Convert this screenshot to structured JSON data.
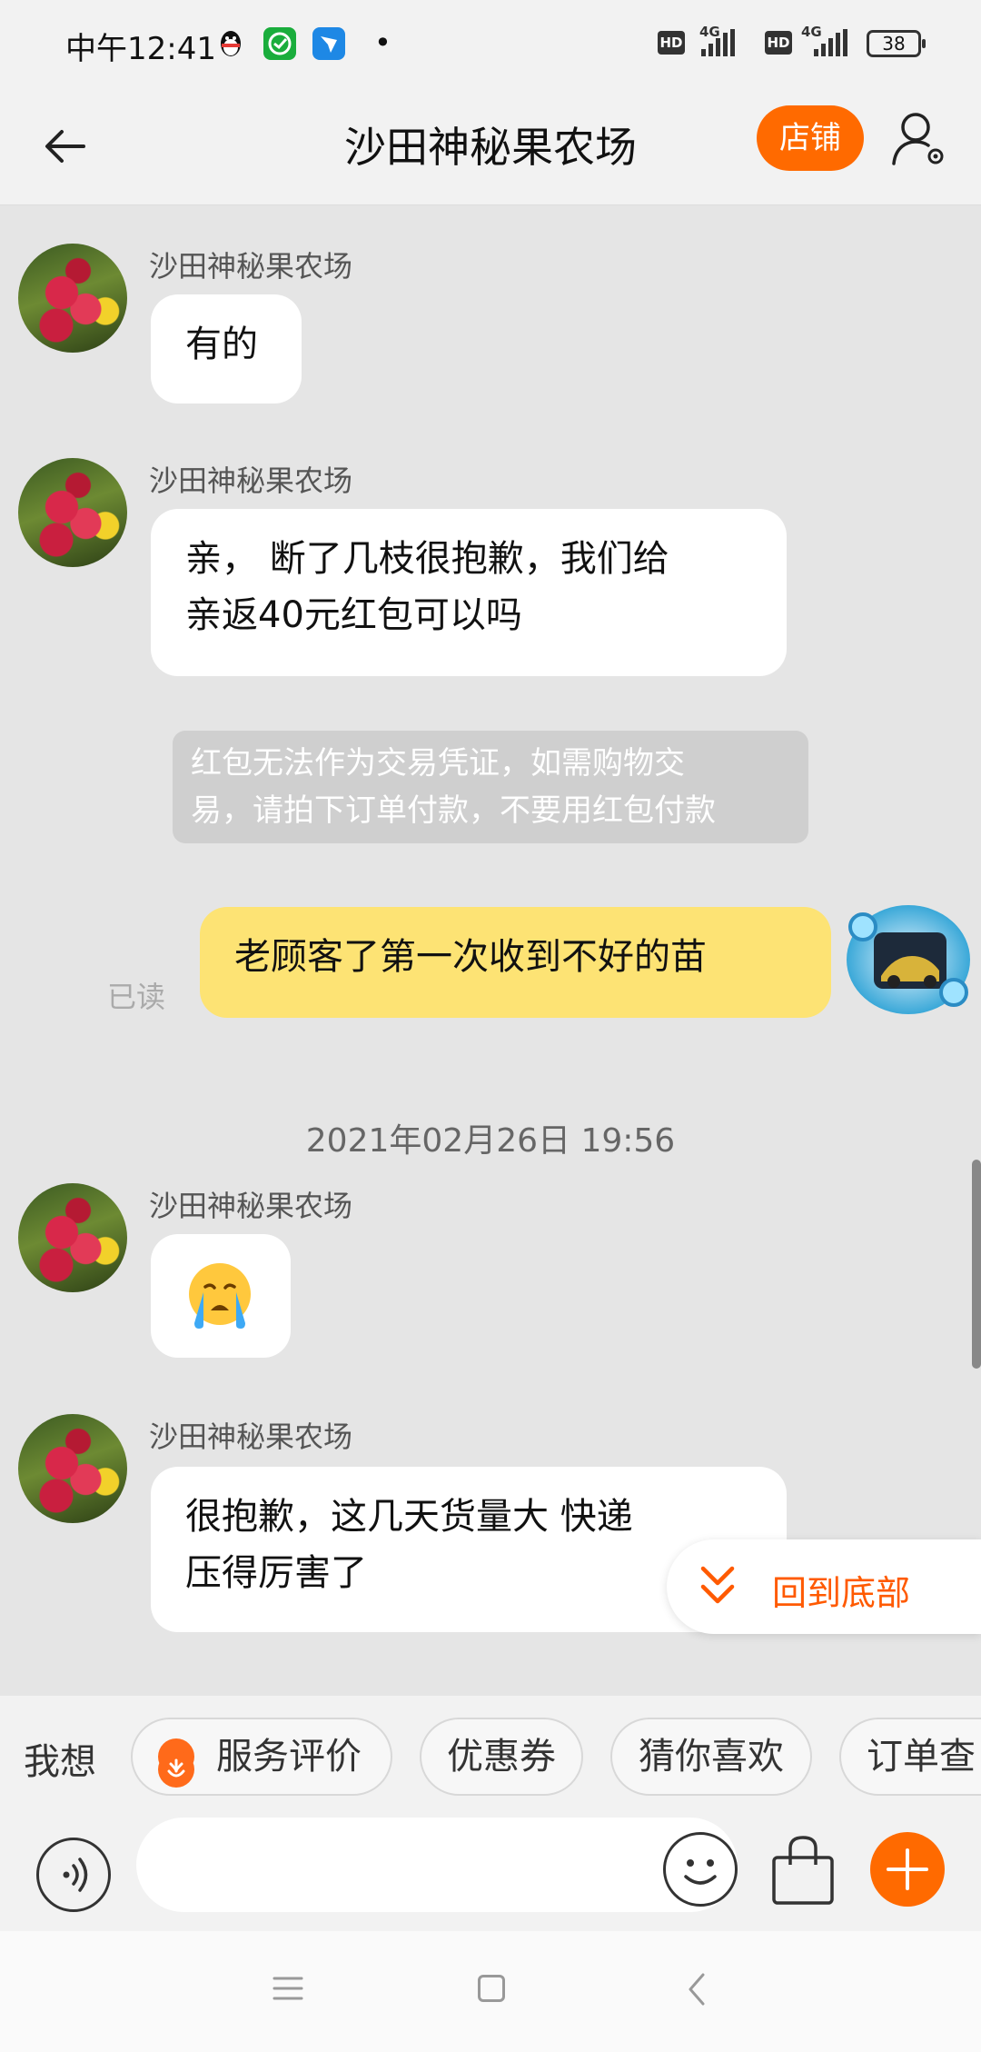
{
  "status_bar": {
    "time": "中午12:41",
    "network_1": "4G",
    "network_2": "4G",
    "hd_1": "HD",
    "hd_2": "HD",
    "battery": "38",
    "icons": [
      "qq-icon",
      "green-app-icon",
      "blue-app-icon"
    ]
  },
  "header": {
    "title": "沙田神秘果农场",
    "shop_button": "店铺"
  },
  "messages": [
    {
      "sender": "沙田神秘果农场",
      "lines": [
        "有的"
      ]
    },
    {
      "sender": "沙田神秘果农场",
      "lines": [
        "亲，  断了几枝很抱歉，我们给",
        "亲返40元红包可以吗"
      ]
    },
    {
      "system": [
        "红包无法作为交易凭证，如需购物交",
        "易，请拍下订单付款，不要用红包付款"
      ]
    },
    {
      "mine": true,
      "text": "老顾客了第一次收到不好的苗",
      "status": "已读"
    },
    {
      "timestamp": "2021年02月26日 19:56"
    },
    {
      "sender": "沙田神秘果农场",
      "emoji": "crying-face"
    },
    {
      "sender": "沙田神秘果农场",
      "lines": [
        "很抱歉，这几天货量大  快递",
        "压得厉害了"
      ]
    }
  ],
  "back_to_bottom": "回到底部",
  "quick_actions": {
    "label": "我想",
    "chips": [
      "服务评价",
      "优惠券",
      "猜你喜欢",
      "订单查"
    ]
  },
  "colors": {
    "accent": "#ff6a00",
    "my_bubble": "#fde374",
    "chat_bg": "#e5e5e5"
  }
}
